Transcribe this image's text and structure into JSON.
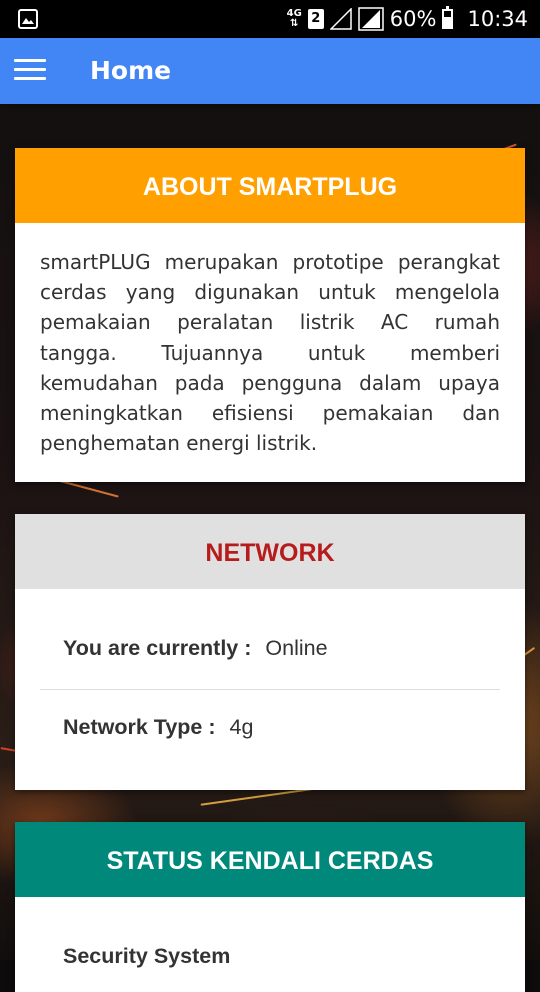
{
  "status_bar": {
    "network_type": "4G",
    "sim_slot": "2",
    "battery_percent": "60%",
    "battery_level": 0.6,
    "time": "10:34"
  },
  "app_bar": {
    "title": "Home",
    "menu_icon": "hamburger-menu-icon"
  },
  "about_card": {
    "header": "ABOUT SMARTPLUG",
    "body": "smartPLUG merupakan prototipe perangkat cerdas yang digunakan untuk mengelola pemakaian peralatan listrik AC rumah tangga. Tujuannya untuk memberi kemudahan pada pengguna dalam upaya meningkatkan efisiensi pemakaian dan penghematan energi listrik."
  },
  "network_card": {
    "header": "NETWORK",
    "status_label": "You are currently :",
    "status_value": "Online",
    "type_label": "Network Type :",
    "type_value": "4g"
  },
  "status_card": {
    "header": "STATUS KENDALI CERDAS",
    "security_label": "Security System"
  },
  "colors": {
    "app_bar": "#4285f4",
    "about_header": "#ffa000",
    "network_header_bg": "#e0e0e0",
    "network_header_text": "#b71c1c",
    "status_header": "#00897b"
  }
}
